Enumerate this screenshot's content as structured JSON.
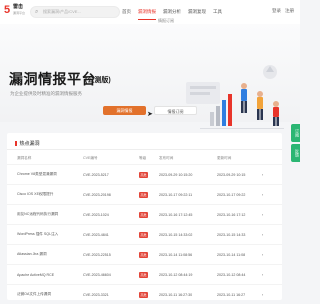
{
  "header": {
    "logo_mark": "5",
    "logo_name": "雷击",
    "logo_sub": "漏洞平台",
    "search_placeholder": "搜索漏洞/产品/CVE...",
    "nav": [
      "首页",
      "漏洞情报",
      "漏洞分析",
      "漏洞复现",
      "工具"
    ],
    "nav_active_index": 1,
    "nav_sub": "情报订阅",
    "auth": [
      "登录",
      "注册"
    ]
  },
  "hero": {
    "title": "漏洞情报平台",
    "badge": "(公测版)",
    "description": "为企业提供及时精准的漏洞情报服务"
  },
  "tabs": {
    "primary": "漏洞情报",
    "secondary": "情报订阅"
  },
  "side_tabs": [
    "订阅",
    "反馈"
  ],
  "card": {
    "title": "热点漏洞",
    "columns": [
      "漏洞名称",
      "CVE编号",
      "等级",
      "发布时间",
      "更新时间",
      ""
    ],
    "rows": [
      {
        "name": "Chrome V8类型混淆漏洞",
        "cve": "CVE-2023-5217",
        "level": "高危",
        "published": "2023-09-29 10:15:20",
        "updated": "2023-09-29 10:15",
        "action": "›"
      },
      {
        "name": "Cisco IOS XE权限提升",
        "cve": "CVE-2023-20198",
        "level": "高危",
        "published": "2023-10-17 09:22:11",
        "updated": "2023-10-17 09:22",
        "action": "›"
      },
      {
        "name": "用友NC远程代码执行漏洞",
        "cve": "CVE-2023-1024",
        "level": "高危",
        "published": "2023-10-16 17:12:45",
        "updated": "2023-10-16 17:12",
        "action": "›"
      },
      {
        "name": "WordPress 插件 SQL注入",
        "cve": "CVE-2023-4841",
        "level": "高危",
        "published": "2023-10-15 14:33:02",
        "updated": "2023-10-15 14:33",
        "action": "›"
      },
      {
        "name": "Atlassian Jira 漏洞",
        "cve": "CVE-2023-22515",
        "level": "高危",
        "published": "2023-10-14 11:08:56",
        "updated": "2023-10-14 11:08",
        "action": "›"
      },
      {
        "name": "Apache ActiveMQ RCE",
        "cve": "CVE-2023-46604",
        "level": "高危",
        "published": "2023-10-12 08:44:19",
        "updated": "2023-10-12 08:44",
        "action": "›"
      },
      {
        "name": "泛微OA文件上传漏洞",
        "cve": "CVE-2023-3321",
        "level": "高危",
        "published": "2023-10-11 16:27:30",
        "updated": "2023-10-11 16:27",
        "action": "›"
      }
    ]
  },
  "colors": {
    "accent": "#e8342a",
    "primary_button": "#e2712b",
    "side_tab": "#2bb673",
    "badge_high": "#e2463a"
  }
}
